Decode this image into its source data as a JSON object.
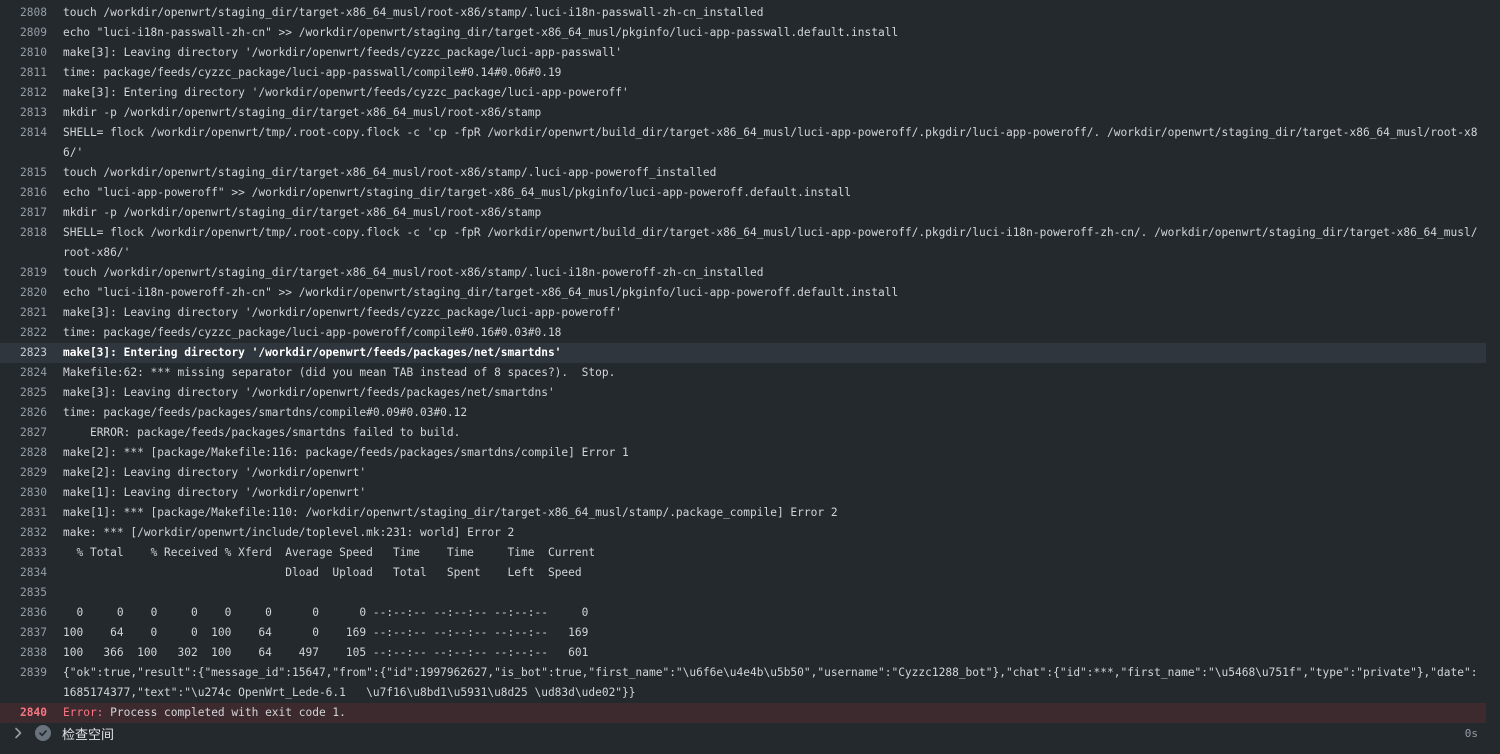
{
  "log": {
    "lines": [
      {
        "n": "2808",
        "t": "touch /workdir/openwrt/staging_dir/target-x86_64_musl/root-x86/stamp/.luci-i18n-passwall-zh-cn_installed"
      },
      {
        "n": "2809",
        "t": "echo \"luci-i18n-passwall-zh-cn\" >> /workdir/openwrt/staging_dir/target-x86_64_musl/pkginfo/luci-app-passwall.default.install"
      },
      {
        "n": "2810",
        "t": "make[3]: Leaving directory '/workdir/openwrt/feeds/cyzzc_package/luci-app-passwall'"
      },
      {
        "n": "2811",
        "t": "time: package/feeds/cyzzc_package/luci-app-passwall/compile#0.14#0.06#0.19"
      },
      {
        "n": "2812",
        "t": "make[3]: Entering directory '/workdir/openwrt/feeds/cyzzc_package/luci-app-poweroff'"
      },
      {
        "n": "2813",
        "t": "mkdir -p /workdir/openwrt/staging_dir/target-x86_64_musl/root-x86/stamp"
      },
      {
        "n": "2814",
        "t": "SHELL= flock /workdir/openwrt/tmp/.root-copy.flock -c 'cp -fpR /workdir/openwrt/build_dir/target-x86_64_musl/luci-app-poweroff/.pkgdir/luci-app-poweroff/. /workdir/openwrt/staging_dir/target-x86_64_musl/root-x86/'"
      },
      {
        "n": "2815",
        "t": "touch /workdir/openwrt/staging_dir/target-x86_64_musl/root-x86/stamp/.luci-app-poweroff_installed"
      },
      {
        "n": "2816",
        "t": "echo \"luci-app-poweroff\" >> /workdir/openwrt/staging_dir/target-x86_64_musl/pkginfo/luci-app-poweroff.default.install"
      },
      {
        "n": "2817",
        "t": "mkdir -p /workdir/openwrt/staging_dir/target-x86_64_musl/root-x86/stamp"
      },
      {
        "n": "2818",
        "t": "SHELL= flock /workdir/openwrt/tmp/.root-copy.flock -c 'cp -fpR /workdir/openwrt/build_dir/target-x86_64_musl/luci-app-poweroff/.pkgdir/luci-i18n-poweroff-zh-cn/. /workdir/openwrt/staging_dir/target-x86_64_musl/root-x86/'"
      },
      {
        "n": "2819",
        "t": "touch /workdir/openwrt/staging_dir/target-x86_64_musl/root-x86/stamp/.luci-i18n-poweroff-zh-cn_installed"
      },
      {
        "n": "2820",
        "t": "echo \"luci-i18n-poweroff-zh-cn\" >> /workdir/openwrt/staging_dir/target-x86_64_musl/pkginfo/luci-app-poweroff.default.install"
      },
      {
        "n": "2821",
        "t": "make[3]: Leaving directory '/workdir/openwrt/feeds/cyzzc_package/luci-app-poweroff'"
      },
      {
        "n": "2822",
        "t": "time: package/feeds/cyzzc_package/luci-app-poweroff/compile#0.16#0.03#0.18"
      },
      {
        "n": "2823",
        "t": "make[3]: Entering directory '/workdir/openwrt/feeds/packages/net/smartdns'"
      },
      {
        "n": "2824",
        "t": "Makefile:62: *** missing separator (did you mean TAB instead of 8 spaces?).  Stop."
      },
      {
        "n": "2825",
        "t": "make[3]: Leaving directory '/workdir/openwrt/feeds/packages/net/smartdns'"
      },
      {
        "n": "2826",
        "t": "time: package/feeds/packages/smartdns/compile#0.09#0.03#0.12"
      },
      {
        "n": "2827",
        "t": "    ERROR: package/feeds/packages/smartdns failed to build."
      },
      {
        "n": "2828",
        "t": "make[2]: *** [package/Makefile:116: package/feeds/packages/smartdns/compile] Error 1"
      },
      {
        "n": "2829",
        "t": "make[2]: Leaving directory '/workdir/openwrt'"
      },
      {
        "n": "2830",
        "t": "make[1]: Leaving directory '/workdir/openwrt'"
      },
      {
        "n": "2831",
        "t": "make[1]: *** [package/Makefile:110: /workdir/openwrt/staging_dir/target-x86_64_musl/stamp/.package_compile] Error 2"
      },
      {
        "n": "2832",
        "t": "make: *** [/workdir/openwrt/include/toplevel.mk:231: world] Error 2"
      },
      {
        "n": "2833",
        "t": "  % Total    % Received % Xferd  Average Speed   Time    Time     Time  Current"
      },
      {
        "n": "2834",
        "t": "                                 Dload  Upload   Total   Spent    Left  Speed"
      },
      {
        "n": "2835",
        "t": ""
      },
      {
        "n": "2836",
        "t": "  0     0    0     0    0     0      0      0 --:--:-- --:--:-- --:--:--     0"
      },
      {
        "n": "2837",
        "t": "100    64    0     0  100    64      0    169 --:--:-- --:--:-- --:--:--   169"
      },
      {
        "n": "2838",
        "t": "100   366  100   302  100    64    497    105 --:--:-- --:--:-- --:--:--   601"
      },
      {
        "n": "2839",
        "t": "{\"ok\":true,\"result\":{\"message_id\":15647,\"from\":{\"id\":1997962627,\"is_bot\":true,\"first_name\":\"\\u6f6e\\u4e4b\\u5b50\",\"username\":\"Cyzzc1288_bot\"},\"chat\":{\"id\":***,\"first_name\":\"\\u5468\\u751f\",\"type\":\"private\"},\"date\":1685174377,\"text\":\"\\u274c OpenWrt_Lede-6.1   \\u7f16\\u8bd1\\u5931\\u8d25 \\ud83d\\ude02\"}}"
      }
    ],
    "error_line": {
      "n": "2840",
      "label": "Error:",
      "t": " Process completed with exit code 1."
    }
  },
  "footer": {
    "step_name": "检查空间",
    "duration": "0s"
  },
  "colors": {
    "background": "#24292e",
    "highlight": "#2f363d",
    "error_bg": "#3c2a2e",
    "error_text": "#f97583"
  }
}
